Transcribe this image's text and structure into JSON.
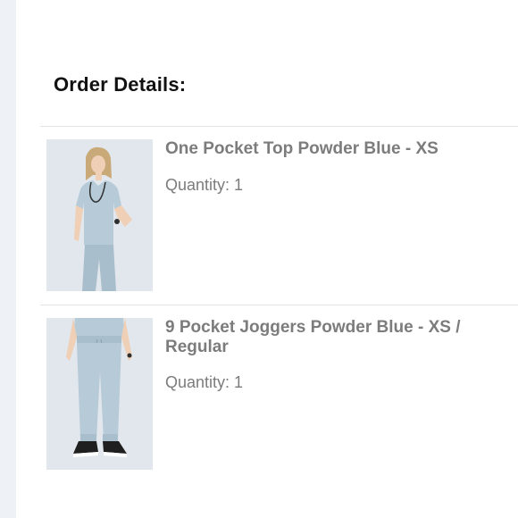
{
  "order": {
    "title": "Order Details:",
    "items": [
      {
        "name": "One Pocket Top Powder Blue - XS",
        "quantity_label": "Quantity:",
        "quantity": "1",
        "image": "product-photo-top-icon"
      },
      {
        "name": "9 Pocket Joggers Powder Blue - XS / Regular",
        "quantity_label": "Quantity:",
        "quantity": "1",
        "image": "product-photo-joggers-icon"
      }
    ]
  },
  "colors": {
    "page_background": "#ffffff",
    "left_rail": "#eef1f6",
    "title_text": "#111111",
    "item_text": "#7c7c7c",
    "divider": "#e2e2e2",
    "garment": "#b7cad8"
  }
}
